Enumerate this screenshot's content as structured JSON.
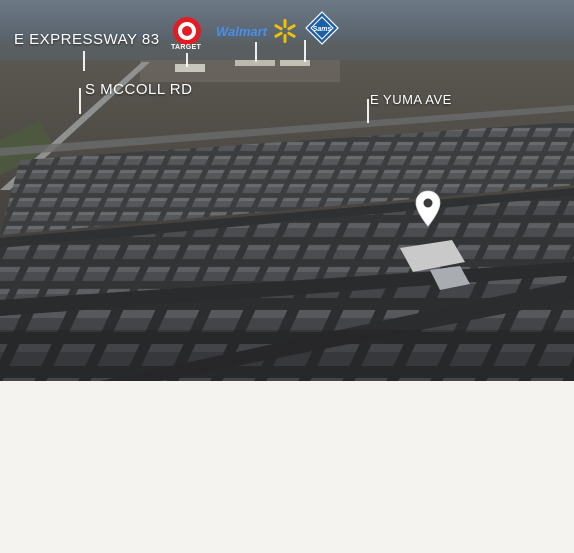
{
  "labels": {
    "highway": "E EXPRESSWAY 83",
    "road_west": "S MCCOLL RD",
    "road_east": "E YUMA AVE"
  },
  "logos": {
    "target": "TARGET",
    "walmart": "Walmart",
    "sams_icon": "sams-club-icon",
    "spark_icon": "walmart-spark-icon"
  },
  "marker": {
    "icon": "map-pin-icon",
    "color": "#ffffff"
  },
  "colors": {
    "sky": "#5b6874",
    "ground": "#3a3a38",
    "background": "#f4f3ef"
  }
}
